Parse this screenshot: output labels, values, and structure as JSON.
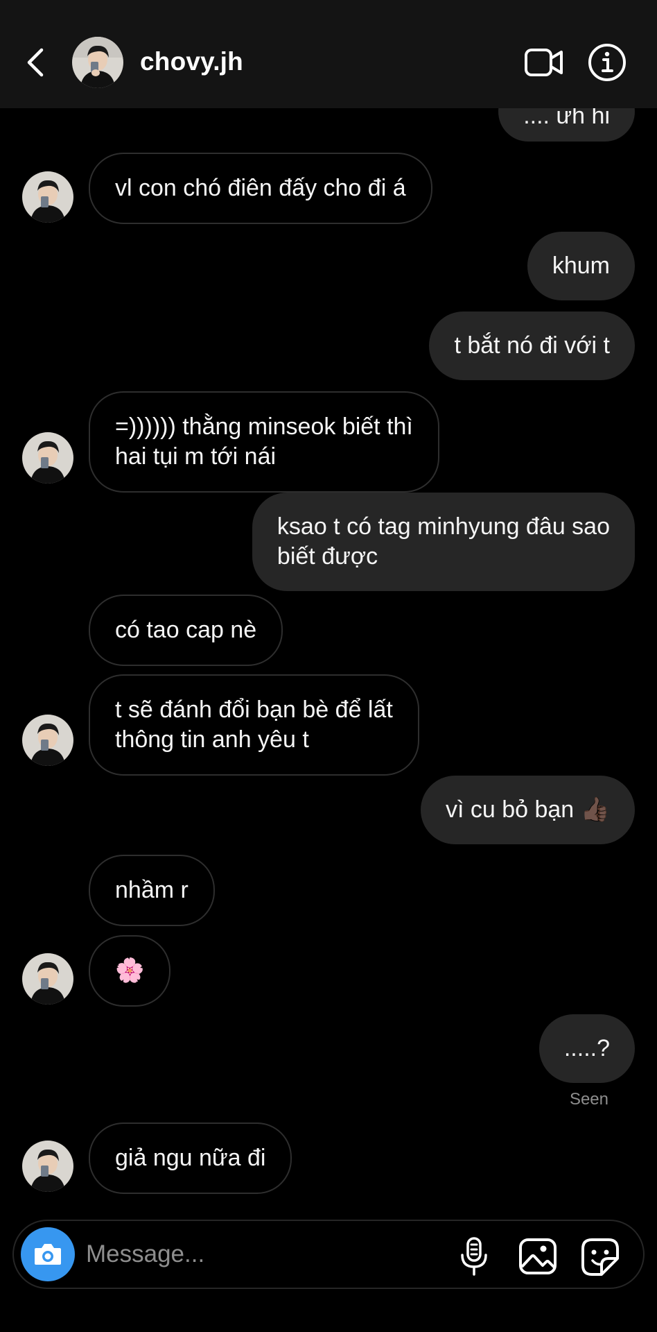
{
  "header": {
    "username": "chovy.jh",
    "back_icon": "chevron-left-icon",
    "video_icon": "video-camera-icon",
    "info_icon": "info-icon"
  },
  "messages": [
    {
      "side": "out",
      "text": ".... ưh hi"
    },
    {
      "side": "in",
      "text": "vl con chó điên đấy cho đi á"
    },
    {
      "side": "out",
      "text": "khum"
    },
    {
      "side": "out",
      "text": "t bắt nó đi với t"
    },
    {
      "side": "in",
      "text": "=)))))) thằng minseok biết thì\nhai tụi m tới nái"
    },
    {
      "side": "out",
      "text": "ksao t có tag minhyung đâu sao\nbiết được"
    },
    {
      "side": "in",
      "text": "có tao cap nè"
    },
    {
      "side": "in",
      "text": "t sẽ đánh đổi bạn bè để lất\nthông tin anh yêu t"
    },
    {
      "side": "out",
      "text": "vì cu bỏ bạn 👍🏿"
    },
    {
      "side": "in",
      "text": "nhầm r"
    },
    {
      "side": "in",
      "text": "🌸"
    },
    {
      "side": "out",
      "text": ".....?"
    },
    {
      "side": "in",
      "text": "giả ngu nữa đi"
    }
  ],
  "seen_label": "Seen",
  "composer": {
    "placeholder": "Message...",
    "camera_icon": "camera-icon",
    "mic_icon": "microphone-icon",
    "gallery_icon": "gallery-icon",
    "sticker_icon": "sticker-icon"
  },
  "colors": {
    "background": "#000000",
    "header": "#141414",
    "outgoing_bubble": "#262626",
    "incoming_border": "#2e2e2e",
    "accent": "#3797f0",
    "muted_text": "#8e8e8e"
  }
}
